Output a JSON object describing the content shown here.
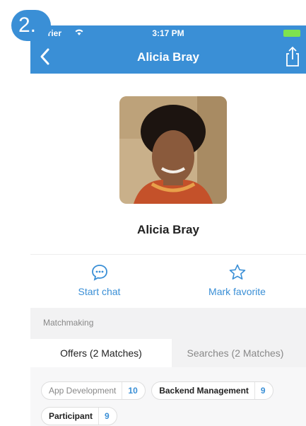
{
  "step_badge": "2.",
  "status_bar": {
    "carrier": "rrier",
    "time": "3:17 PM"
  },
  "nav": {
    "title": "Alicia Bray"
  },
  "profile": {
    "name": "Alicia Bray"
  },
  "actions": {
    "chat_label": "Start chat",
    "favorite_label": "Mark favorite"
  },
  "section": {
    "title": "Matchmaking"
  },
  "tabs": [
    {
      "label": "Offers (2 Matches)"
    },
    {
      "label": "Searches (2 Matches)"
    }
  ],
  "tags": [
    {
      "name": "App Development",
      "count": "10"
    },
    {
      "name": "Backend Management",
      "count": "9"
    },
    {
      "name": "Participant",
      "count": "9"
    }
  ],
  "colors": {
    "accent": "#3a8fd6",
    "battery": "#7ee24e",
    "section_bg": "#f2f2f3"
  }
}
